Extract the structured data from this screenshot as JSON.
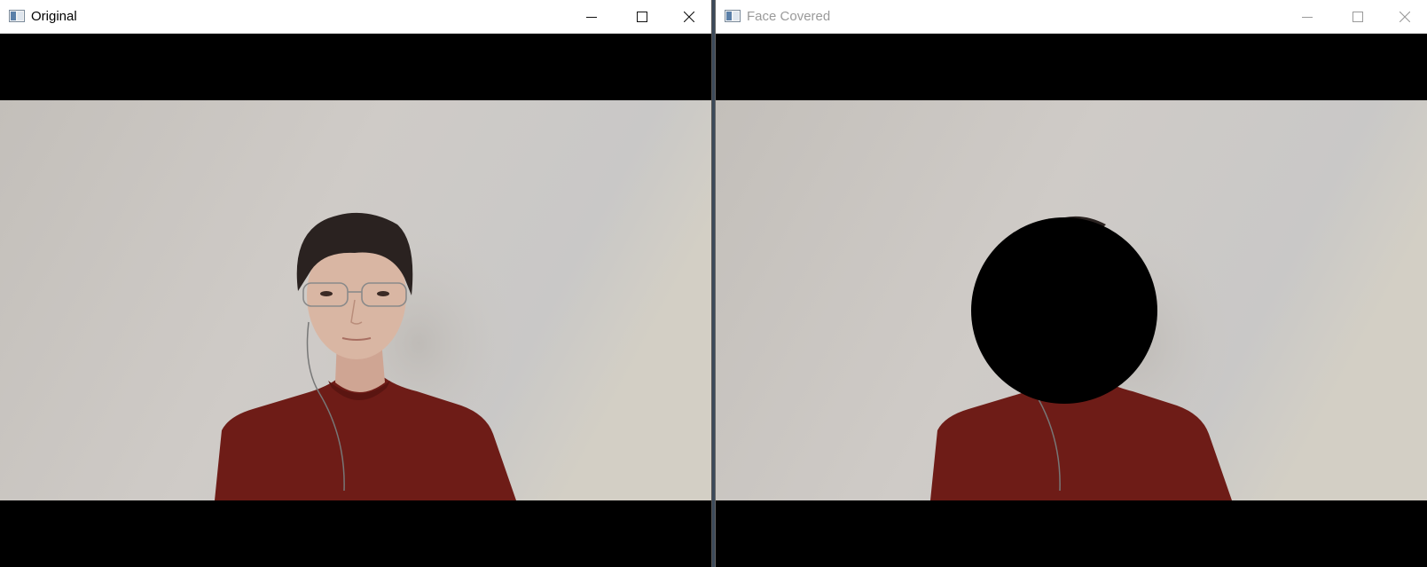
{
  "windows": {
    "original": {
      "title": "Original",
      "state": "active",
      "controls": {
        "minimize_icon": "minimize-icon",
        "maximize_icon": "maximize-icon",
        "close_icon": "close-icon"
      }
    },
    "covered": {
      "title": "Face Covered",
      "state": "inactive",
      "controls": {
        "minimize_icon": "minimize-icon",
        "maximize_icon": "maximize-icon",
        "close_icon": "close-icon"
      }
    }
  },
  "colors": {
    "wall": "#cfcbc6",
    "shirt": "#6e1c17",
    "hair": "#2a2220",
    "skin": "#d9b6a3",
    "cover_circle": "#000000",
    "letterbox": "#000000"
  }
}
